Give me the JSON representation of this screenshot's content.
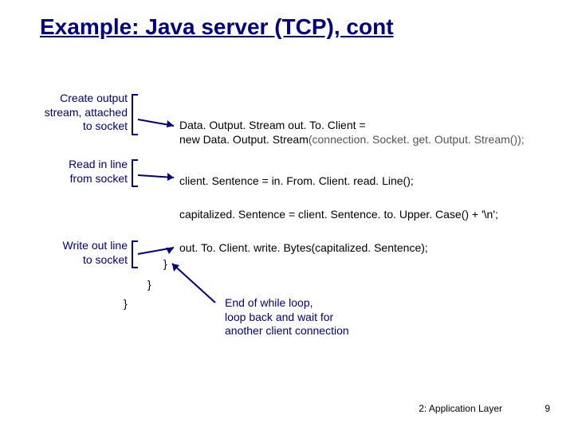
{
  "title": "Example: Java server (TCP), cont",
  "notes": {
    "n1_l1": "Create output",
    "n1_l2": "stream, attached",
    "n1_l3": "to socket",
    "n2_l1": "Read in  line",
    "n2_l2": "from socket",
    "n3_l1": "Write out line",
    "n3_l2": "to socket"
  },
  "code": {
    "c1_l1a": "Data. Output. Stream  out. To. Client = ",
    "c1_l2a": " new Data. Output. Stream",
    "c1_l2b": "(connection. Socket. get. Output. Stream());",
    "c2": "client. Sentence = in. From. Client. read. Line();",
    "c3": "capitalized. Sentence = client. Sentence. to. Upper. Case() + '\\n';",
    "c4": "out. To. Client. write. Bytes(capitalized. Sentence);",
    "brace1": "}",
    "brace2": "}",
    "brace3": "}"
  },
  "endnote": {
    "l1": "End of while loop,",
    "l2": "loop back and wait for",
    "l3": "another client connection"
  },
  "footer": {
    "text": "2: Application Layer",
    "page": "9"
  }
}
